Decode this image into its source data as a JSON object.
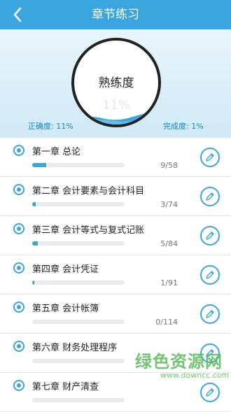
{
  "header": {
    "title": "章节练习",
    "back_icon": "chevron-left-icon"
  },
  "hero": {
    "label": "熟练度",
    "percent": "11%",
    "accuracy": "正确度: 11%",
    "completion": "完成度: 1%",
    "wave_color": "#3aa6dd"
  },
  "chapters": [
    {
      "name": "第一章 总论",
      "count": "9/58",
      "progress": 0.155
    },
    {
      "name": "第二章 会计要素与会计科目",
      "count": "3/74",
      "progress": 0.041
    },
    {
      "name": "第三章 会计等式与复式记账",
      "count": "5/84",
      "progress": 0.06
    },
    {
      "name": "第四章 会计凭证",
      "count": "1/91",
      "progress": 0.011
    },
    {
      "name": "第五章 会计帐簿",
      "count": "0/114",
      "progress": 0
    },
    {
      "name": "第六章 财务处理程序",
      "count": "",
      "progress": 0
    },
    {
      "name": "第七章 财产清查",
      "count": "",
      "progress": 0
    }
  ],
  "watermark": {
    "text": "绿色资源网",
    "url": "www.downcc.com"
  },
  "colors": {
    "accent": "#3aa6dd",
    "text": "#222222",
    "muted": "#777777"
  }
}
